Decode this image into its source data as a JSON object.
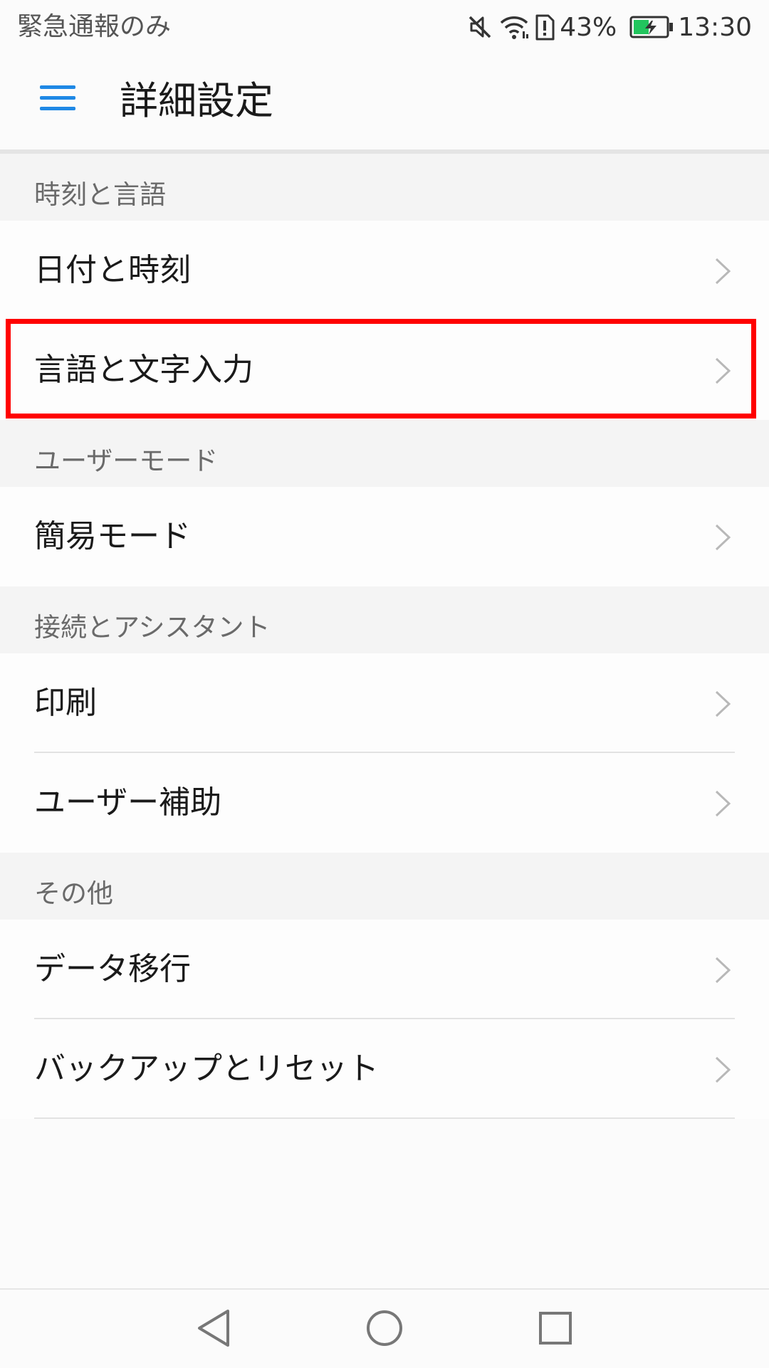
{
  "status_bar": {
    "carrier_text": "緊急通報のみ",
    "battery_percent": "43%",
    "time": "13:30",
    "icons": [
      "mute-icon",
      "wifi-icon",
      "sim-alert-icon",
      "battery-charging-icon"
    ],
    "battery_color": "#22c55e"
  },
  "header": {
    "title": "詳細設定",
    "menu_icon": "hamburger-menu-icon",
    "accent_color": "#1e88e5"
  },
  "sections": [
    {
      "header": "時刻と言語",
      "items": [
        "日付と時刻",
        "言語と文字入力"
      ]
    },
    {
      "header": "ユーザーモード",
      "items": [
        "簡易モード"
      ]
    },
    {
      "header": "接続とアシスタント",
      "items": [
        "印刷",
        "ユーザー補助"
      ]
    },
    {
      "header": "その他",
      "items": [
        "データ移行",
        "バックアップとリセット"
      ]
    }
  ],
  "highlight_color": "#ff0000",
  "nav_bar": {
    "icons": [
      "back-icon",
      "home-icon",
      "recents-icon"
    ]
  }
}
